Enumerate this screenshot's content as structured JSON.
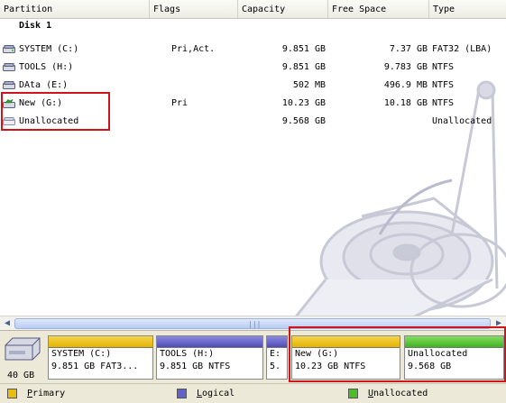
{
  "columns": [
    "Partition",
    "Flags",
    "Capacity",
    "Free Space",
    "Type"
  ],
  "disk": {
    "title": "Disk 1",
    "size": "40 GB"
  },
  "partitions": [
    {
      "name": "SYSTEM (C:)",
      "flags": "Pri,Act.",
      "capacity": "9.851 GB",
      "free": "7.37 GB",
      "type": "FAT32 (LBA)",
      "icon": "drive-icon"
    },
    {
      "name": "TOOLS (H:)",
      "flags": "",
      "capacity": "9.851 GB",
      "free": "9.783 GB",
      "type": "NTFS",
      "icon": "drive-icon"
    },
    {
      "name": "DAta (E:)",
      "flags": "",
      "capacity": "502 MB",
      "free": "496.9 MB",
      "type": "NTFS",
      "icon": "drive-icon"
    },
    {
      "name": "New (G:)",
      "flags": "Pri",
      "capacity": "10.23 GB",
      "free": "10.18 GB",
      "type": "NTFS",
      "icon": "new-drive-icon"
    },
    {
      "name": "Unallocated",
      "flags": "",
      "capacity": "9.568 GB",
      "free": "",
      "type": "Unallocated",
      "icon": "unallocated-icon"
    }
  ],
  "diskmap": [
    {
      "line1": "SYSTEM (C:)",
      "line2": "9.851 GB  FAT3...",
      "kind": "primary"
    },
    {
      "line1": "TOOLS (H:)",
      "line2": "9.851 GB  NTFS",
      "kind": "logical"
    },
    {
      "line1": "E:",
      "line2": "5.",
      "kind": "logical"
    },
    {
      "line1": "New (G:)",
      "line2": "10.23 GB  NTFS",
      "kind": "primary"
    },
    {
      "line1": "Unallocated",
      "line2": "9.568 GB",
      "kind": "unalloc"
    }
  ],
  "legend": {
    "primary": "Primary",
    "logical": "Logical",
    "unallocated": "Unallocated"
  },
  "colors": {
    "primary": "#e8bd10",
    "logical": "#6462c8",
    "unallocated": "#4cbc2a",
    "highlight": "#d0141a"
  }
}
